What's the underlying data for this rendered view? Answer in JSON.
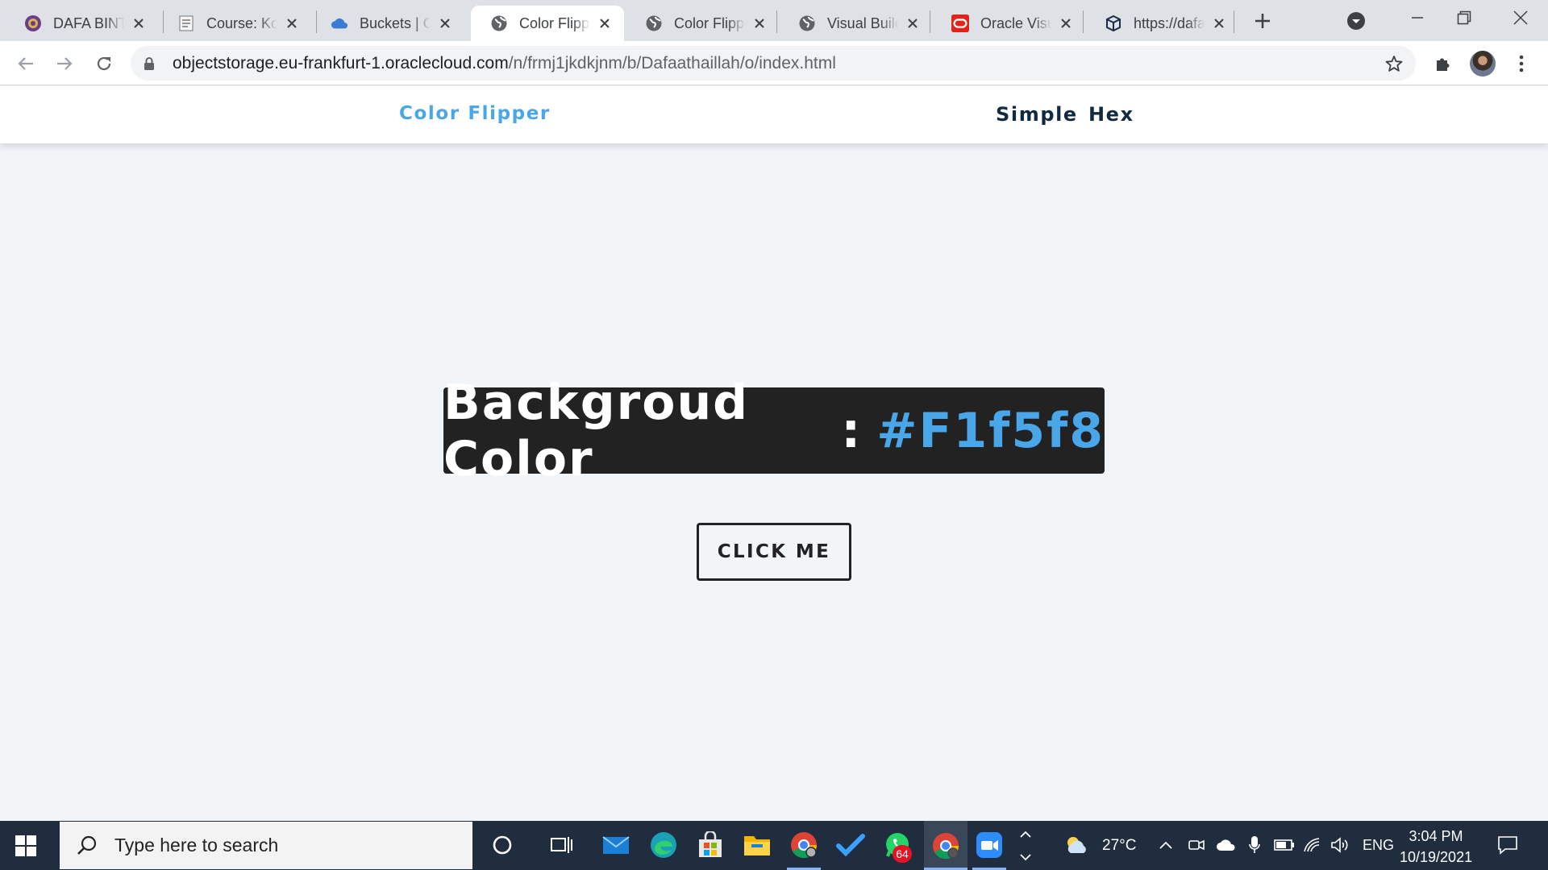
{
  "browser": {
    "tabs": [
      {
        "title": "DAFA BINTANG",
        "favicon": "university-crest-icon",
        "active": false
      },
      {
        "title": "Course: Komputasi",
        "favicon": "course-icon",
        "active": false
      },
      {
        "title": "Buckets | Oracle",
        "favicon": "cloud-icon",
        "active": false
      },
      {
        "title": "Color Flipper",
        "favicon": "globe-icon",
        "active": true
      },
      {
        "title": "Color Flipper",
        "favicon": "globe-icon",
        "active": false
      },
      {
        "title": "Visual Builder",
        "favicon": "globe-icon",
        "active": false
      },
      {
        "title": "Oracle Visual",
        "favicon": "oracle-icon",
        "active": false
      },
      {
        "title": "https://dafaa",
        "favicon": "cube-icon",
        "active": false
      }
    ],
    "url_host": "objectstorage.eu-frankfurt-1.oraclecloud.com",
    "url_path": "/n/frmj1jkdkjnm/b/Dafaathaillah/o/index.html"
  },
  "page": {
    "brand": "Color Flipper",
    "nav": {
      "simple": "Simple",
      "hex": "Hex"
    },
    "color_label": "Backgroud Color",
    "color_separator": ":",
    "color_value": "#F1f5f8",
    "button_label": "CLICK ME",
    "colors": {
      "accent": "#49a6e9",
      "background": "#f1f5f8",
      "dark": "#222222",
      "nav_text": "#102a42"
    }
  },
  "taskbar": {
    "search_placeholder": "Type here to search",
    "whatsapp_badge": "64",
    "weather": "27°C",
    "language": "ENG",
    "time": "3:04 PM",
    "date": "10/19/2021"
  }
}
